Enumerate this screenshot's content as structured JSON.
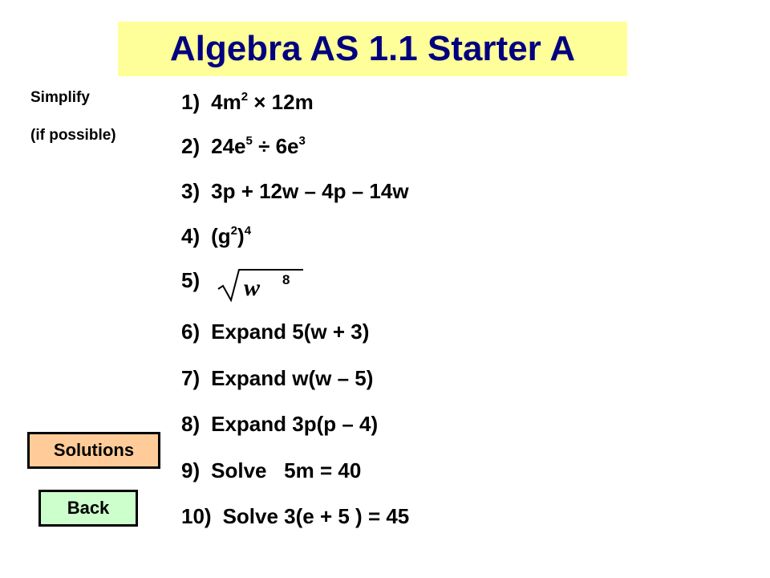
{
  "title": "Algebra AS 1.1 Starter A",
  "instruction": {
    "line1": "Simplify",
    "line2": "(if possible)"
  },
  "questions": [
    {
      "num": "1)",
      "base1": "4m",
      "sup1": "2",
      "rest1": " × 12m"
    },
    {
      "num": "2)",
      "base1": "24e",
      "sup1": "5",
      "mid": " ÷ 6e",
      "sup2": "3"
    },
    {
      "num": "3)",
      "expr": "3p + 12w – 4p – 14w"
    },
    {
      "num": "4)",
      "base1": "(g",
      "sup1": "2",
      "mid": ")",
      "sup2": "4"
    },
    {
      "num": "5)",
      "radicand": "w",
      "exponent": "8"
    },
    {
      "num": "6)",
      "expr": "Expand 5(w + 3)"
    },
    {
      "num": "7)",
      "expr": "Expand w(w – 5)"
    },
    {
      "num": "8)",
      "expr": "Expand 3p(p – 4)"
    },
    {
      "num": "9)",
      "expr": "Solve   5m = 40"
    },
    {
      "num": "10)",
      "expr": "Solve 3(e + 5 ) = 45"
    }
  ],
  "buttons": {
    "solutions": "Solutions",
    "back": "Back"
  },
  "colors": {
    "title_bg": "#ffff99",
    "title_text": "#000080",
    "solutions_bg": "#ffcc99",
    "back_bg": "#ccffcc"
  }
}
